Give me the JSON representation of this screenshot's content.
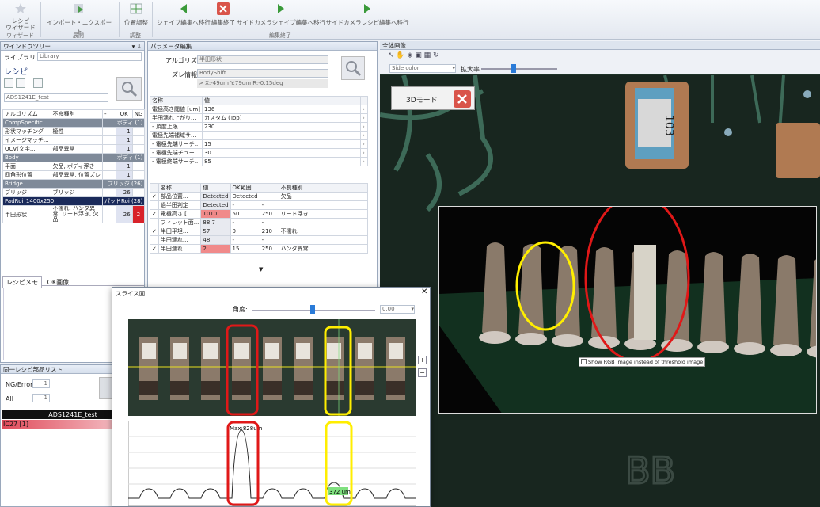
{
  "ribbon": {
    "items": [
      {
        "label": "レシピ\nウィザード",
        "name": "recipe-wizard-button"
      },
      {
        "label": "インポート・エクスポート",
        "name": "import-export-button"
      },
      {
        "label": "位置調整",
        "name": "position-adjust-button"
      },
      {
        "label": "シェイプ編集へ移行",
        "name": "shape-edit-button"
      },
      {
        "label": "編集終了",
        "name": "edit-end-button"
      },
      {
        "label": "サイドカメラシェイプ編集へ移行",
        "name": "side-camera-shape-edit-button"
      },
      {
        "label": "サイドカメラレシピ編集へ移行",
        "name": "side-camera-recipe-edit-button"
      }
    ],
    "groups": [
      "ウィザード",
      "展開",
      "調整",
      "編集終了"
    ]
  },
  "window_panel": {
    "title": "ウインドウツリー",
    "pin": "▾ ⇩",
    "library_label": "ライブラリ",
    "library_value": "Library",
    "recipe_label": "レシピ",
    "recipe_value": "ADS1241E_test"
  },
  "recipe_table": {
    "headers": [
      "アルゴリズム",
      "不良種別",
      "-",
      "OK",
      "NG"
    ],
    "rows": [
      {
        "type": "cat",
        "a": "CompSpecific",
        "b": "",
        "c": "ボディ (1)"
      },
      {
        "type": "row",
        "a": "形状マッチング",
        "b": "極性",
        "ok": "1",
        "ng": ""
      },
      {
        "type": "row",
        "a": "イメージマッチ...",
        "b": "",
        "ok": "1",
        "ng": ""
      },
      {
        "type": "row",
        "a": "OCV(文字...",
        "b": "部品異常",
        "ok": "1",
        "ng": ""
      },
      {
        "type": "cat",
        "a": "Body",
        "b": "",
        "c": "ボディ (1)"
      },
      {
        "type": "row",
        "a": "平面",
        "b": "欠品, ボディ浮き",
        "ok": "1",
        "ng": ""
      },
      {
        "type": "row",
        "a": "四角形位置",
        "b": "部品異常, 位置ズレ",
        "ok": "1",
        "ng": ""
      },
      {
        "type": "cat",
        "a": "Bridge",
        "b": "",
        "c": "ブリッジ (26)"
      },
      {
        "type": "row",
        "a": "ブリッジ",
        "b": "ブリッジ",
        "ok": "26",
        "ng": ""
      },
      {
        "type": "sel",
        "a": "PadRoi_1400x250",
        "b": "",
        "c": "パッドRoi (28)"
      },
      {
        "type": "row2",
        "a": "半田形状",
        "b": "不濡れ, ハンダ異常, リード浮き, 欠品",
        "ok": "26",
        "ng": "2"
      }
    ]
  },
  "lower_tabs": [
    "レシピメモ",
    "OK画像"
  ],
  "same_list": {
    "title": "同一レシピ部品リスト",
    "ng_label": "NG/Error",
    "ng_value": "1",
    "all_label": "All",
    "all_value": "1",
    "header": "ADS1241E_test",
    "item": "IC27 [1]"
  },
  "param_panel": {
    "title": "パラメータ編集",
    "algo_label": "アルゴリズム",
    "algo_value": "半田形状",
    "shift_label": "ズレ情報",
    "shift_value": "BodyShift",
    "shift_detail": "X:-49um Y:79um R:-0.15deg",
    "param_headers": [
      "名称",
      "値"
    ],
    "params": [
      {
        "n": "電極高さ閾値 [um]",
        "v": "136"
      },
      {
        "n": "半田濡れ上がり...",
        "v": "カスタム (Top)"
      },
      {
        "n": "- 頂度上限",
        "v": "230"
      },
      {
        "n": "電極先端補域サ...",
        "v": ""
      },
      {
        "n": "- 電極先端サーチ...",
        "v": "15"
      },
      {
        "n": "- 電極先端チュー...",
        "v": "30"
      },
      {
        "n": "- 電極終端サーチ...",
        "v": "85"
      }
    ],
    "result_headers": [
      "名称",
      "値",
      "OK範囲",
      "",
      "不良種別"
    ],
    "results": [
      {
        "chk": "✓",
        "n": "部品位置...",
        "v": "Detected",
        "lo": "Detected",
        "hi": "",
        "d": "欠品",
        "bad": false
      },
      {
        "chk": "",
        "n": "過半田判定",
        "v": "Detected",
        "lo": "-",
        "hi": "-",
        "d": "",
        "bad": false
      },
      {
        "chk": "✓",
        "n": "電極高さ [...",
        "v": "1010",
        "lo": "50",
        "hi": "250",
        "d": "リード浮き",
        "bad": true
      },
      {
        "chk": "",
        "n": "フィレット面...",
        "v": "88.7",
        "lo": "-",
        "hi": "-",
        "d": "",
        "bad": false
      },
      {
        "chk": "✓",
        "n": "半田平坦...",
        "v": "57",
        "lo": "0",
        "hi": "210",
        "d": "不濡れ",
        "bad": false
      },
      {
        "chk": "",
        "n": "半田濡れ...",
        "v": "48",
        "lo": "-",
        "hi": "-",
        "d": "",
        "bad": false
      },
      {
        "chk": "✓",
        "n": "半田濡れ...",
        "v": "2",
        "lo": "15",
        "hi": "250",
        "d": "ハンダ異常",
        "bad": true
      }
    ]
  },
  "image_panel": {
    "title": "全体画像",
    "mode_label": "Side color",
    "zoom_label": "拡大率",
    "mode3d_button": "3Dモード",
    "rgb_checkbox": "Show RGB image instead of threshold image",
    "chip_text": "103",
    "silk_text": "BB"
  },
  "slice": {
    "title": "スライス面",
    "angle_label": "角度:",
    "angle_value": "0.00",
    "max_label": "Max:828um",
    "val_label": "372 um"
  }
}
